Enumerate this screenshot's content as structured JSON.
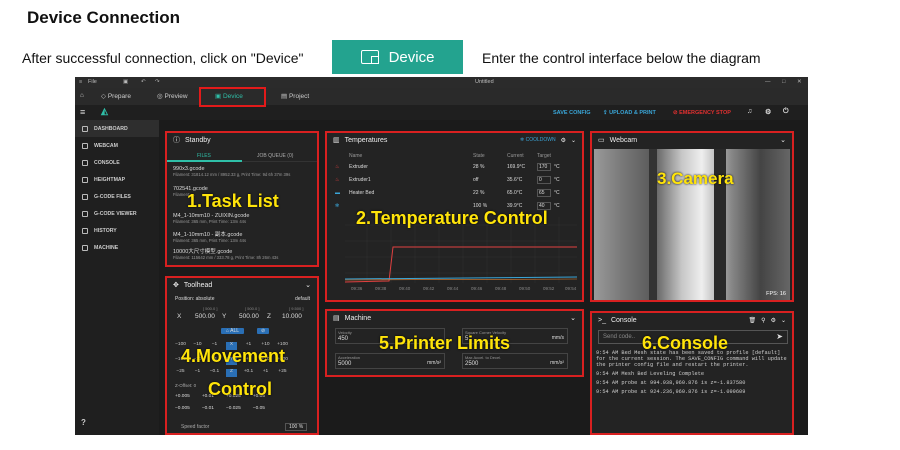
{
  "doc": {
    "title": "Device Connection",
    "instr_left": "After successful connection, click on \"Device\"",
    "device_button": "Device",
    "instr_right": "Enter the control interface below the diagram"
  },
  "app": {
    "title": "Untitled",
    "menu_file": "File",
    "tabs": [
      "Prepare",
      "Preview",
      "Device",
      "Project"
    ],
    "toolbar": {
      "save": "SAVE CONFIG",
      "upload": "UPLOAD & PRINT",
      "estop": "EMERGENCY STOP"
    },
    "sidebar": [
      "DASHBOARD",
      "WEBCAM",
      "CONSOLE",
      "HEIGHTMAP",
      "G-CODE FILES",
      "G-CODE VIEWER",
      "HISTORY",
      "MACHINE"
    ],
    "standby": {
      "title": "Standby",
      "tab_files": "FILES",
      "tab_queue": "JOB QUEUE (0)",
      "jobs": [
        {
          "name": "990x3.gcode",
          "sub": "Filament: 31814.12 mm / 8952.33 g, Print Time: 9d 6h 37m 39s"
        },
        {
          "name": "702541.gcode",
          "sub": "Filament: ..."
        },
        {
          "name": "M4_1-10mm10 - ZUIXIN.gcode",
          "sub": "Filament: 365 mm, Print Time: 13m 44s"
        },
        {
          "name": "M4_1-10mm10 - 副本.gcode",
          "sub": "Filament: 365 mm, Print Time: 13m 44s"
        },
        {
          "name": "10000大尺寸模型.gcode",
          "sub": "Filament: 115642 mm / 333.78 g, Print Time: 8h 26m 43s"
        }
      ]
    },
    "temps": {
      "title": "Temperatures",
      "cooldown": "COOLDOWN",
      "headers": [
        "Name",
        "State",
        "Current",
        "Target"
      ],
      "rows": [
        {
          "name": "Extruder",
          "state": "28 %",
          "current": "169.9°C",
          "target": "170",
          "unit": "°C"
        },
        {
          "name": "Extruder1",
          "state": "off",
          "current": "35.6°C",
          "target": "0",
          "unit": "°C"
        },
        {
          "name": "Heater Bed",
          "state": "22 %",
          "current": "65.0°C",
          "target": "65",
          "unit": "°C"
        },
        {
          "name": "",
          "state": "100 %",
          "current": "39.9°C",
          "target": "40",
          "unit": "°C"
        }
      ],
      "times": [
        "09:36",
        "09:38",
        "09:40",
        "09:42",
        "09:44",
        "09:46",
        "09:48",
        "09:50",
        "09:52",
        "09:54"
      ]
    },
    "webcam": {
      "title": "Webcam",
      "fps": "FPS: 16"
    },
    "toolhead": {
      "title": "Toolhead",
      "position": "Position: absolute",
      "default": "default",
      "x_label": "X",
      "x_val": "500.00",
      "x_max": "[ 500.0 ]",
      "y_label": "Y",
      "y_val": "500.00",
      "y_max": "[ 500.0 ]",
      "z_label": "Z",
      "z_val": "10.000",
      "z_max": "[ 9.500 ]",
      "all": "ALL",
      "row1": [
        "−100",
        "−10",
        "−1",
        "X",
        "+1",
        "+10",
        "+100"
      ],
      "row2": [
        "−100",
        "−10",
        "−1",
        "Y",
        "+1",
        "+10",
        "+100"
      ],
      "row3": [
        "−25",
        "−1",
        "−0.1",
        "Z",
        "+0.1",
        "+1",
        "+25"
      ],
      "zoffset": "Z-Offset: 0",
      "zo1": [
        "+0.005",
        "+0.01",
        "+0.025",
        "+0.05"
      ],
      "zo2": [
        "−0.005",
        "−0.01",
        "−0.025",
        "−0.05"
      ],
      "speed": "Speed factor",
      "speed_val": "100"
    },
    "machine": {
      "title": "Machine",
      "velocity_label": "Velocity",
      "velocity": "450",
      "velocity_unit": "mm/s",
      "scv_label": "Square Corner Velocity",
      "scv": "5",
      "scv_unit": "mm/s",
      "accel_label": "Acceleration",
      "accel": "5000",
      "accel_unit": "mm/s²",
      "decel_label": "Max Accel. to Decel.",
      "decel": "2500",
      "decel_unit": "mm/s²"
    },
    "console": {
      "title": "Console",
      "placeholder": "Send code..",
      "lines": [
        "9:54 AM  Bed Mesh state has been saved to profile [default] for the current session. The SAVE_CONFIG command will update the printer config file and restart the printer.",
        "9:54 AM  Mesh Bed Leveling Complete",
        "9:54 AM  probe at 994.938,960.876 is z=-1.837580",
        "9:54 AM  probe at 924.236,960.876 is z=-1.099609"
      ]
    }
  },
  "labels": {
    "task": "1.Task List",
    "temp": "2.Temperature Control",
    "camera": "3.Camera",
    "move1": "4.Movement",
    "move2": "Control",
    "limits": "5.Printer Limits",
    "console": "6.Console"
  },
  "colors": {
    "accent": "#2fbfa8",
    "highlight": "#e21a1a",
    "label": "#ffe40a",
    "button": "#23a38f"
  }
}
